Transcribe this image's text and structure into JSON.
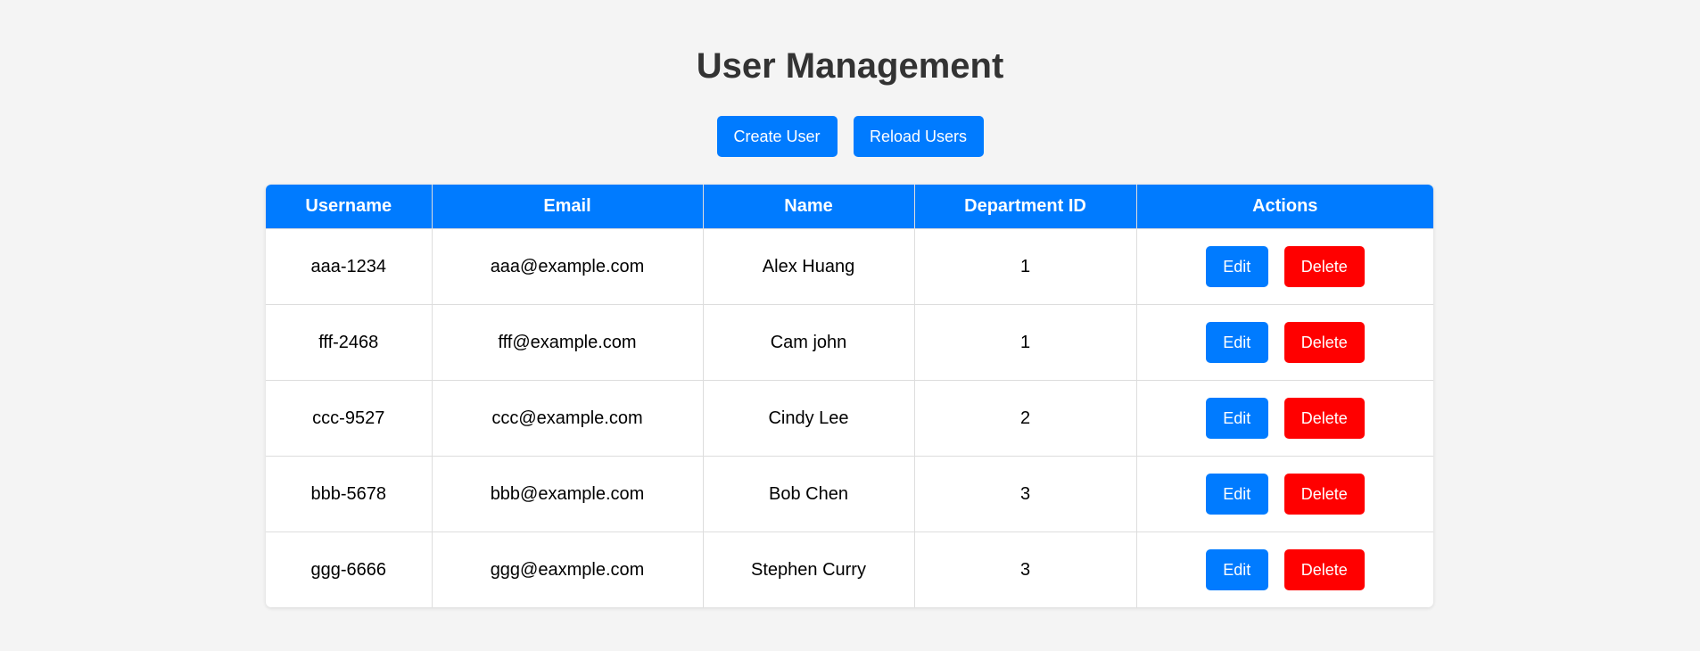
{
  "header": {
    "title": "User Management"
  },
  "toolbar": {
    "create_label": "Create User",
    "reload_label": "Reload Users"
  },
  "table": {
    "columns": [
      "Username",
      "Email",
      "Name",
      "Department ID",
      "Actions"
    ],
    "rows": [
      {
        "username": "aaa-1234",
        "email": "aaa@example.com",
        "name": "Alex Huang",
        "department_id": "1"
      },
      {
        "username": "fff-2468",
        "email": "fff@example.com",
        "name": "Cam john",
        "department_id": "1"
      },
      {
        "username": "ccc-9527",
        "email": "ccc@example.com",
        "name": "Cindy Lee",
        "department_id": "2"
      },
      {
        "username": "bbb-5678",
        "email": "bbb@example.com",
        "name": "Bob Chen",
        "department_id": "3"
      },
      {
        "username": "ggg-6666",
        "email": "ggg@eaxmple.com",
        "name": "Stephen Curry",
        "department_id": "3"
      }
    ],
    "edit_label": "Edit",
    "delete_label": "Delete"
  },
  "colors": {
    "primary": "#007bff",
    "danger": "#ff0000",
    "background": "#f4f4f4",
    "title": "#333333"
  }
}
